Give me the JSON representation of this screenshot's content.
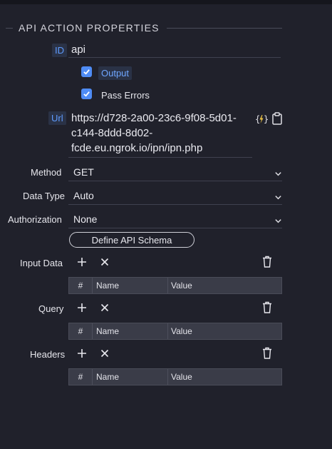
{
  "section": {
    "title": "API ACTION PROPERTIES"
  },
  "id_field": {
    "label": "ID",
    "value": "api"
  },
  "output_checkbox": {
    "label": "Output",
    "checked": true
  },
  "pass_errors_checkbox": {
    "label": "Pass Errors",
    "checked": true
  },
  "url_field": {
    "label": "Url",
    "lines": [
      "https://d728-2a00-23c6-9f08-5d01-",
      "c144-8ddd-8d02-",
      "fcde.eu.ngrok.io/ipn/ipn.php"
    ]
  },
  "method": {
    "label": "Method",
    "value": "GET"
  },
  "data_type": {
    "label": "Data Type",
    "value": "Auto"
  },
  "authorization": {
    "label": "Authorization",
    "value": "None"
  },
  "define_schema": {
    "label": "Define API Schema"
  },
  "table_columns": {
    "hash": "#",
    "name": "Name",
    "value": "Value"
  },
  "input_data": {
    "label": "Input Data"
  },
  "query": {
    "label": "Query"
  },
  "headers": {
    "label": "Headers"
  },
  "colors": {
    "background": "#20212b",
    "accent": "#4f8cf5",
    "tag_text": "#5e9bff"
  }
}
